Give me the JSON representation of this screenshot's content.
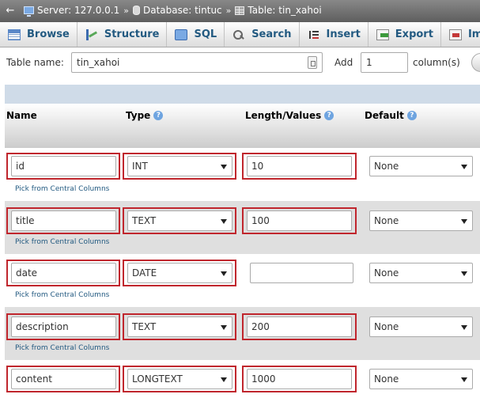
{
  "breadcrumb": {
    "server": "Server: 127.0.0.1",
    "database": "Database: tintuc",
    "table": "Table: tin_xahoi",
    "separator": "»",
    "back": "←"
  },
  "tabs": [
    {
      "label": "Browse",
      "icon": "browse-icon"
    },
    {
      "label": "Structure",
      "icon": "structure-icon"
    },
    {
      "label": "SQL",
      "icon": "sql-icon"
    },
    {
      "label": "Search",
      "icon": "search-icon"
    },
    {
      "label": "Insert",
      "icon": "insert-icon"
    },
    {
      "label": "Export",
      "icon": "export-icon"
    },
    {
      "label": "Imp",
      "icon": "import-icon"
    }
  ],
  "table_form": {
    "name_label": "Table name:",
    "name_value": "tin_xahoi",
    "add_label": "Add",
    "add_value": "1",
    "columns_label": "column(s)"
  },
  "headers": {
    "name": "Name",
    "type": "Type",
    "length": "Length/Values",
    "default": "Default",
    "help": "?"
  },
  "pick_label": "Pick from Central Columns",
  "rows": [
    {
      "name": "id",
      "type": "INT",
      "length": "10",
      "default": "None"
    },
    {
      "name": "title",
      "type": "TEXT",
      "length": "100",
      "default": "None"
    },
    {
      "name": "date",
      "type": "DATE",
      "length": "",
      "default": "None"
    },
    {
      "name": "description",
      "type": "TEXT",
      "length": "200",
      "default": "None"
    },
    {
      "name": "content",
      "type": "LONGTEXT",
      "length": "1000",
      "default": "None"
    }
  ],
  "colors": {
    "highlight": "#c0262d",
    "link": "#235a81",
    "row_alt": "#dfdfdf",
    "grid_band": "#cfdbe8"
  }
}
